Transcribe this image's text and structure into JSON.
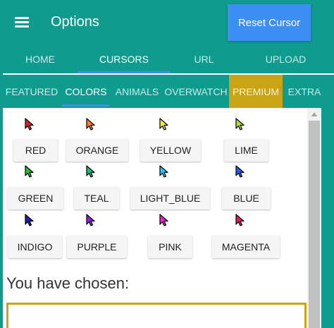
{
  "app": {
    "title": "Options",
    "reset_label": "Reset Cursor"
  },
  "main_tabs": [
    {
      "label": "HOME"
    },
    {
      "label": "CURSORS",
      "active": true
    },
    {
      "label": "URL"
    },
    {
      "label": "UPLOAD"
    }
  ],
  "sub_tabs": [
    {
      "label": "FEATURED"
    },
    {
      "label": "COLORS",
      "active": true
    },
    {
      "label": "ANIMALS"
    },
    {
      "label": "OVERWATCH"
    },
    {
      "label": "PREMIUM",
      "highlight": "#c9a414"
    },
    {
      "label": "EXTRA"
    }
  ],
  "colors": [
    {
      "label": "RED",
      "cursor_color": "#e02020"
    },
    {
      "label": "ORANGE",
      "cursor_color": "#ff7f27"
    },
    {
      "label": "YELLOW",
      "cursor_color": "#ffee22"
    },
    {
      "label": "LIME",
      "cursor_color": "#a6e62e"
    },
    {
      "label": "GREEN",
      "cursor_color": "#22c22e"
    },
    {
      "label": "TEAL",
      "cursor_color": "#1fb97d"
    },
    {
      "label": "LIGHT_BLUE",
      "cursor_color": "#29c4ef"
    },
    {
      "label": "BLUE",
      "cursor_color": "#1c5ff0"
    },
    {
      "label": "INDIGO",
      "cursor_color": "#1f1fb0"
    },
    {
      "label": "PURPLE",
      "cursor_color": "#8e21d6"
    },
    {
      "label": "PINK",
      "cursor_color": "#e626c9"
    },
    {
      "label": "MAGENTA",
      "cursor_color": "#e0205a"
    }
  ],
  "chosen": {
    "label": "You have chosen:"
  },
  "theme": {
    "primary": "#0f9b8e",
    "accent": "#3d8ff5",
    "premium": "#c9a414"
  }
}
